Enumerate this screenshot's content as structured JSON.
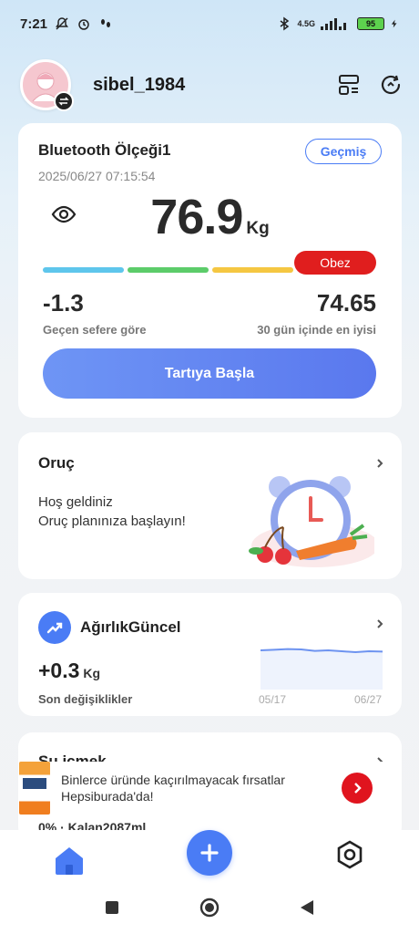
{
  "status": {
    "time": "7:21",
    "battery": "95",
    "network": "4.5G"
  },
  "header": {
    "username": "sibel_1984"
  },
  "scale_card": {
    "device_name": "Bluetooth Ölçeği1",
    "history_label": "Geçmiş",
    "datetime": "2025/06/27 07:15:54",
    "weight": "76.9",
    "unit": "Kg",
    "bmi_status": "Obez",
    "change_value": "-1.3",
    "change_label": "Geçen sefere göre",
    "best_value": "74.65",
    "best_label": "30 gün içinde en iyisi",
    "start_button": "Tartıya Başla"
  },
  "fasting_card": {
    "title": "Oruç",
    "line1": "Hoş geldiniz",
    "line2": "Oruç planınıza başlayın!"
  },
  "weight_card": {
    "title": "AğırlıkGüncel",
    "change": "+0.3",
    "unit": "Kg",
    "label": "Son değişiklikler",
    "date_start": "05/17",
    "date_end": "06/27",
    "trend": [
      0.55,
      0.58,
      0.62,
      0.6,
      0.52,
      0.55,
      0.5,
      0.45,
      0.5,
      0.48
    ]
  },
  "water_card": {
    "title": "Su içmek",
    "remaining": "0% · Kalan2087ml"
  },
  "ad": {
    "text": "Binlerce üründe kaçırılmayacak fırsatlar Hepsiburada'da!"
  },
  "colors": {
    "accent": "#4a7cf5",
    "obese": "#e01e1e",
    "bmi_blue": "#5ec6ec",
    "bmi_green": "#5ccc6a",
    "bmi_yellow": "#f5c742"
  }
}
